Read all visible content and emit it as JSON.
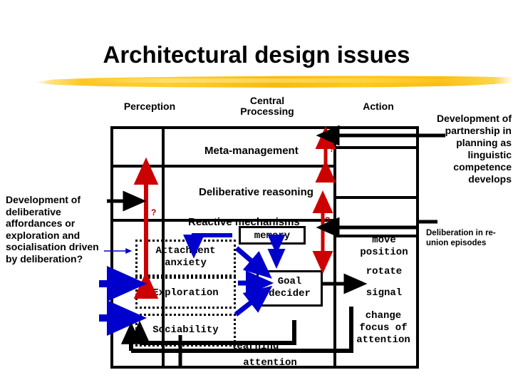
{
  "slide": {
    "title": "Architectural design issues",
    "background_color": "#ffffff",
    "accent_color": "#F5BE12"
  },
  "column_headers": [
    {
      "label": "Perception",
      "id": "perception"
    },
    {
      "label": "Central\nProcessing",
      "line1": "Central",
      "line2": "Processing",
      "id": "central-processing"
    },
    {
      "label": "Action",
      "id": "action"
    }
  ],
  "layers": [
    {
      "label": "Meta-management",
      "id": "meta-management"
    },
    {
      "label": "Deliberative reasoning",
      "id": "deliberative-reasoning"
    },
    {
      "label": "Reactive mechanisms",
      "id": "reactive-mechanisms"
    }
  ],
  "reactive_modules": [
    {
      "label": "Attachment\nanxiety",
      "line1": "Attachment",
      "line2": "anxiety",
      "id": "attachment-anxiety"
    },
    {
      "label": "Exploration",
      "id": "exploration"
    },
    {
      "label": "Sociability",
      "id": "sociability"
    }
  ],
  "components": {
    "memory": "memory",
    "goal_decider_line1": "Goal",
    "goal_decider_line2": "decider"
  },
  "action_outputs": [
    {
      "line1": "move",
      "line2": "position",
      "id": "move-position"
    },
    {
      "line1": "rotate",
      "line2": "",
      "id": "rotate"
    },
    {
      "line1": "signal",
      "line2": "",
      "id": "signal"
    },
    {
      "line1": "change",
      "line2": "focus of",
      "line3": "attention",
      "id": "change-focus-of-attention"
    }
  ],
  "feedback_labels": {
    "learning": "learning",
    "attention": "attention"
  },
  "question_marks": {
    "perception_up": "?",
    "meta_action": "?",
    "reactive_action": "?"
  },
  "notes": {
    "left": "Development of deliberative affordances or exploration and socialisation driven by deliberation?",
    "right_top": "Development of partnership in planning as linguistic competence develops",
    "right_bottom": "Deliberation in re-union episodes"
  },
  "colors": {
    "red_arrow": "#CC0000",
    "blue_arrow": "#0000CC",
    "black": "#000000",
    "brush_yellow": "#F8BC0C"
  }
}
